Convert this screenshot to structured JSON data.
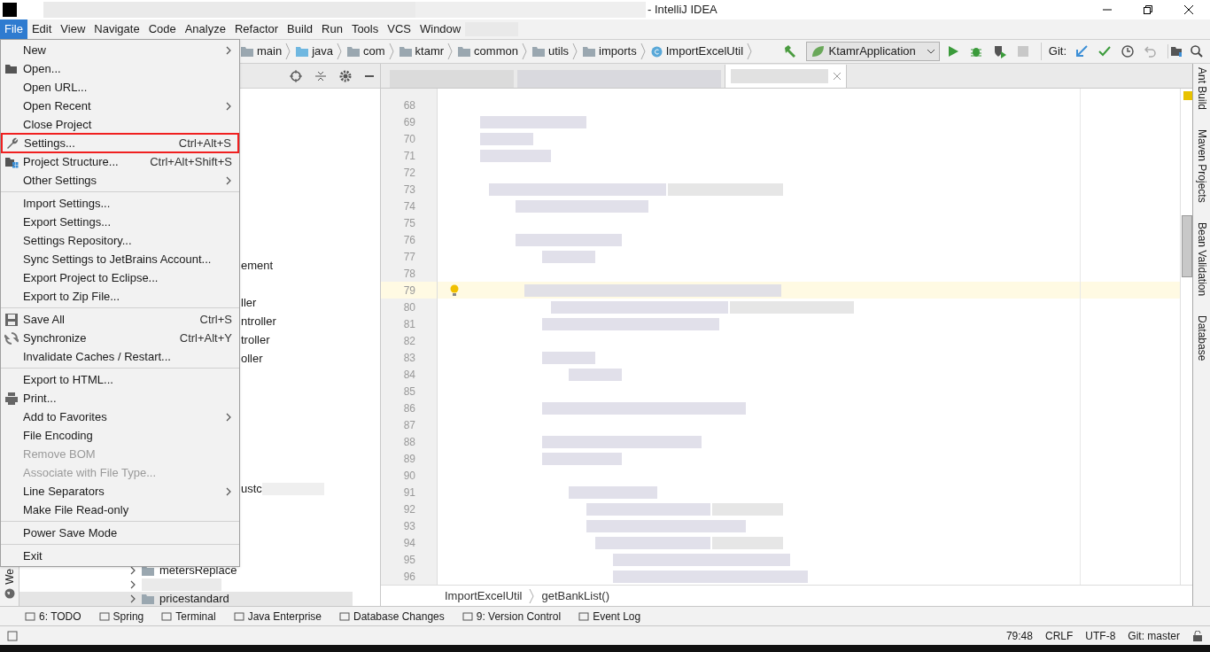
{
  "window": {
    "title": "- IntelliJ IDEA"
  },
  "menu_bar": [
    {
      "label": "File",
      "selected": true
    },
    {
      "label": "Edit",
      "selected": false
    },
    {
      "label": "View",
      "selected": false
    },
    {
      "label": "Navigate",
      "selected": false
    },
    {
      "label": "Code",
      "selected": false
    },
    {
      "label": "Analyze",
      "selected": false
    },
    {
      "label": "Refactor",
      "selected": false
    },
    {
      "label": "Build",
      "selected": false
    },
    {
      "label": "Run",
      "selected": false
    },
    {
      "label": "Tools",
      "selected": false
    },
    {
      "label": "VCS",
      "selected": false
    },
    {
      "label": "Window",
      "selected": false
    }
  ],
  "breadcrumbs": [
    {
      "label": "main",
      "kind": "folder"
    },
    {
      "label": "java",
      "kind": "source"
    },
    {
      "label": "com",
      "kind": "folder"
    },
    {
      "label": "ktamr",
      "kind": "folder"
    },
    {
      "label": "common",
      "kind": "folder"
    },
    {
      "label": "utils",
      "kind": "folder"
    },
    {
      "label": "imports",
      "kind": "folder"
    },
    {
      "label": "ImportExcelUtil",
      "kind": "class"
    }
  ],
  "run_config": "KtamrApplication",
  "git_label": "Git:",
  "file_menu": [
    {
      "kind": "item",
      "label": "New",
      "submenu": true,
      "disabled": false,
      "highlighted": false
    },
    {
      "kind": "item",
      "label": "Open...",
      "submenu": false,
      "disabled": false,
      "highlighted": false
    },
    {
      "kind": "item",
      "label": "Open URL...",
      "submenu": false,
      "disabled": false,
      "highlighted": false
    },
    {
      "kind": "item",
      "label": "Open Recent",
      "submenu": true,
      "disabled": false,
      "highlighted": false
    },
    {
      "kind": "item",
      "label": "Close Project",
      "submenu": false,
      "disabled": false,
      "highlighted": false
    },
    {
      "kind": "item",
      "label": "Settings...",
      "shortcut": "Ctrl+Alt+S",
      "submenu": false,
      "disabled": false,
      "highlighted": true
    },
    {
      "kind": "item",
      "label": "Project Structure...",
      "shortcut": "Ctrl+Alt+Shift+S",
      "submenu": false,
      "disabled": false,
      "highlighted": false
    },
    {
      "kind": "item",
      "label": "Other Settings",
      "submenu": true,
      "disabled": false,
      "highlighted": false
    },
    {
      "kind": "separator"
    },
    {
      "kind": "item",
      "label": "Import Settings...",
      "submenu": false,
      "disabled": false,
      "highlighted": false
    },
    {
      "kind": "item",
      "label": "Export Settings...",
      "submenu": false,
      "disabled": false,
      "highlighted": false
    },
    {
      "kind": "item",
      "label": "Settings Repository...",
      "submenu": false,
      "disabled": false,
      "highlighted": false
    },
    {
      "kind": "item",
      "label": "Sync Settings to JetBrains Account...",
      "submenu": false,
      "disabled": false,
      "highlighted": false
    },
    {
      "kind": "item",
      "label": "Export Project to Eclipse...",
      "submenu": false,
      "disabled": false,
      "highlighted": false
    },
    {
      "kind": "item",
      "label": "Export to Zip File...",
      "submenu": false,
      "disabled": false,
      "highlighted": false
    },
    {
      "kind": "separator"
    },
    {
      "kind": "item",
      "label": "Save All",
      "shortcut": "Ctrl+S",
      "submenu": false,
      "disabled": false,
      "highlighted": false
    },
    {
      "kind": "item",
      "label": "Synchronize",
      "shortcut": "Ctrl+Alt+Y",
      "submenu": false,
      "disabled": false,
      "highlighted": false
    },
    {
      "kind": "item",
      "label": "Invalidate Caches / Restart...",
      "submenu": false,
      "disabled": false,
      "highlighted": false
    },
    {
      "kind": "separator"
    },
    {
      "kind": "item",
      "label": "Export to HTML...",
      "submenu": false,
      "disabled": false,
      "highlighted": false
    },
    {
      "kind": "item",
      "label": "Print...",
      "submenu": false,
      "disabled": false,
      "highlighted": false
    },
    {
      "kind": "item",
      "label": "Add to Favorites",
      "submenu": true,
      "disabled": false,
      "highlighted": false
    },
    {
      "kind": "item",
      "label": "File Encoding",
      "submenu": false,
      "disabled": false,
      "highlighted": false
    },
    {
      "kind": "item",
      "label": "Remove BOM",
      "submenu": false,
      "disabled": true,
      "highlighted": false
    },
    {
      "kind": "item",
      "label": "Associate with File Type...",
      "submenu": false,
      "disabled": true,
      "highlighted": false
    },
    {
      "kind": "item",
      "label": "Line Separators",
      "submenu": true,
      "disabled": false,
      "highlighted": false
    },
    {
      "kind": "item",
      "label": "Make File Read-only",
      "submenu": false,
      "disabled": false,
      "highlighted": false
    },
    {
      "kind": "separator"
    },
    {
      "kind": "item",
      "label": "Power Save Mode",
      "submenu": false,
      "disabled": false,
      "highlighted": false
    },
    {
      "kind": "separator"
    },
    {
      "kind": "item",
      "label": "Exit",
      "submenu": false,
      "disabled": false,
      "highlighted": false
    }
  ],
  "project_tree": [
    {
      "kind": "fragment",
      "label": "ement"
    },
    {
      "kind": "gap"
    },
    {
      "kind": "fragment",
      "label": "ller"
    },
    {
      "kind": "fragment",
      "label": "ntroller"
    },
    {
      "kind": "fragment",
      "label": "troller"
    },
    {
      "kind": "fragment",
      "label": "oller"
    },
    {
      "kind": "gap"
    },
    {
      "kind": "gap"
    },
    {
      "kind": "gap"
    },
    {
      "kind": "gap"
    },
    {
      "kind": "gap"
    },
    {
      "kind": "gap"
    },
    {
      "kind": "fragment",
      "label": "ustc"
    },
    {
      "kind": "gap"
    },
    {
      "kind": "gap"
    },
    {
      "kind": "gap"
    },
    {
      "kind": "package",
      "label": "metersReplace",
      "selected": false
    },
    {
      "kind": "blurred"
    },
    {
      "kind": "package",
      "label": "pricestandard",
      "selected": true
    }
  ],
  "left_strip": "We",
  "line_numbers": [
    {
      "number": "68",
      "current": false
    },
    {
      "number": "69",
      "current": false
    },
    {
      "number": "70",
      "current": false
    },
    {
      "number": "71",
      "current": false
    },
    {
      "number": "72",
      "current": false
    },
    {
      "number": "73",
      "current": false
    },
    {
      "number": "74",
      "current": false
    },
    {
      "number": "75",
      "current": false
    },
    {
      "number": "76",
      "current": false
    },
    {
      "number": "77",
      "current": false
    },
    {
      "number": "78",
      "current": false
    },
    {
      "number": "79",
      "current": true
    },
    {
      "number": "80",
      "current": false
    },
    {
      "number": "81",
      "current": false
    },
    {
      "number": "82",
      "current": false
    },
    {
      "number": "83",
      "current": false
    },
    {
      "number": "84",
      "current": false
    },
    {
      "number": "85",
      "current": false
    },
    {
      "number": "86",
      "current": false
    },
    {
      "number": "87",
      "current": false
    },
    {
      "number": "88",
      "current": false
    },
    {
      "number": "89",
      "current": false
    },
    {
      "number": "90",
      "current": false
    },
    {
      "number": "91",
      "current": false
    },
    {
      "number": "92",
      "current": false
    },
    {
      "number": "93",
      "current": false
    },
    {
      "number": "94",
      "current": false
    },
    {
      "number": "95",
      "current": false
    },
    {
      "number": "96",
      "current": false
    }
  ],
  "editor_breadcrumbs": [
    "ImportExcelUtil",
    "getBankList()"
  ],
  "right_strip": [
    "Ant Build",
    "Maven Projects",
    "Bean Validation",
    "Database"
  ],
  "tool_tabs": [
    "6: TODO",
    "Spring",
    "Terminal",
    "Java Enterprise",
    "Database Changes",
    "9: Version Control",
    "Event Log"
  ],
  "status_bar": {
    "position": "79:48",
    "line_ending": "CRLF",
    "encoding": "UTF-8",
    "git_branch": "Git: master"
  }
}
